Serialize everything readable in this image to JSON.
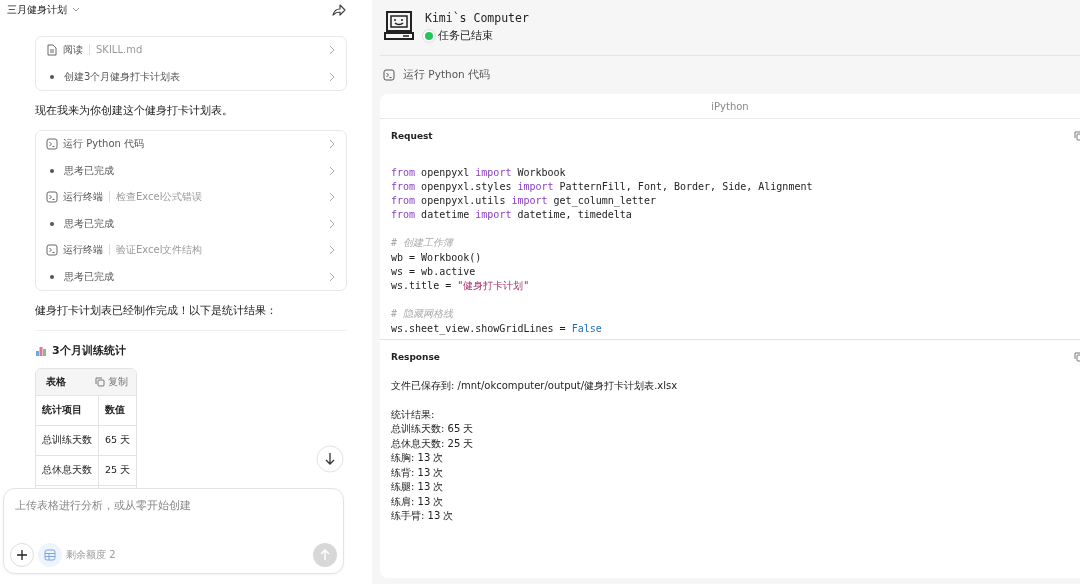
{
  "chat": {
    "title": "三月健身计划",
    "steps_1": [
      {
        "kind": "file",
        "label": "阅读",
        "detail": "SKILL.md"
      },
      {
        "kind": "dot",
        "label": "创建3个月健身打卡计划表"
      }
    ],
    "message_1": "现在我来为你创建这个健身打卡计划表。",
    "steps_2": [
      {
        "kind": "terminal",
        "label": "运行 Python 代码"
      },
      {
        "kind": "dot",
        "label": "思考已完成"
      },
      {
        "kind": "terminal",
        "label": "运行终端",
        "detail": "检查Excel公式错误"
      },
      {
        "kind": "dot",
        "label": "思考已完成"
      },
      {
        "kind": "terminal",
        "label": "运行终端",
        "detail": "验证Excel文件结构"
      },
      {
        "kind": "dot",
        "label": "思考已完成"
      }
    ],
    "message_2": "健身打卡计划表已经制作完成！以下是统计结果：",
    "heading": "3个月训练统计",
    "table": {
      "title": "表格",
      "copy": "复制",
      "columns": [
        "统计项目",
        "数值"
      ],
      "rows": [
        [
          "总训练天数",
          "65 天"
        ],
        [
          "总休息天数",
          "25 天"
        ]
      ]
    },
    "input": {
      "placeholder": "上传表格进行分析，或从零开始创建",
      "quota": "剩余额度 2"
    }
  },
  "computer": {
    "title": "Kimi`s Computer",
    "status": "任务已结束",
    "done": true,
    "action": "运行 Python 代码",
    "panel": {
      "title": "iPython",
      "request_label": "Request",
      "response_label": "Response",
      "code": [
        [
          [
            {
              "kind": "keyword",
              "text": "from"
            },
            {
              "kind": "plain",
              "text": " openpyxl "
            },
            {
              "kind": "keyword",
              "text": "import"
            },
            {
              "kind": "plain",
              "text": " Workbook"
            }
          ],
          [
            {
              "kind": "keyword",
              "text": "from"
            },
            {
              "kind": "plain",
              "text": " openpyxl.styles "
            },
            {
              "kind": "keyword",
              "text": "import"
            },
            {
              "kind": "plain",
              "text": " PatternFill, Font, Border, Side, Alignment"
            }
          ],
          [
            {
              "kind": "keyword",
              "text": "from"
            },
            {
              "kind": "plain",
              "text": " openpyxl.utils "
            },
            {
              "kind": "keyword",
              "text": "import"
            },
            {
              "kind": "plain",
              "text": " get_column_letter"
            }
          ],
          [
            {
              "kind": "keyword",
              "text": "from"
            },
            {
              "kind": "plain",
              "text": " datetime "
            },
            {
              "kind": "keyword",
              "text": "import"
            },
            {
              "kind": "plain",
              "text": " datetime, timedelta"
            }
          ]
        ],
        [
          [
            {
              "kind": "comment",
              "text": "# 创建工作簿"
            }
          ],
          [
            {
              "kind": "plain",
              "text": "wb = Workbook()"
            }
          ],
          [
            {
              "kind": "plain",
              "text": "ws = wb.active"
            }
          ],
          [
            {
              "kind": "plain",
              "text": "ws.title = "
            },
            {
              "kind": "string",
              "text": "\"健身打卡计划\""
            }
          ]
        ],
        [
          [
            {
              "kind": "comment",
              "text": "# 隐藏网格线"
            }
          ],
          [
            {
              "kind": "plain",
              "text": "ws.sheet_view.showGridLines = "
            },
            {
              "kind": "constant",
              "text": "False"
            }
          ]
        ]
      ],
      "response": [
        [
          "文件已保存到: /mnt/okcomputer/output/健身打卡计划表.xlsx"
        ],
        [
          "统计结果:",
          "总训练天数: 65 天",
          "总休息天数: 25 天",
          "练胸: 13 次",
          "练背: 13 次",
          "练腿: 13 次",
          "练肩: 13 次",
          "练手臂: 13 次"
        ]
      ]
    }
  }
}
